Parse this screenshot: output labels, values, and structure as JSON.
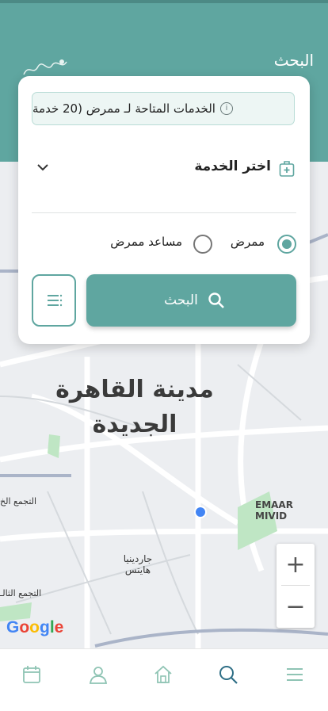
{
  "header": {
    "title": "البحث"
  },
  "search_card": {
    "info_text": "الخدمات المتاحة لـ ممرض (20 خدمة",
    "service_select": "اختر الخدمة",
    "radio_nurse": "ممرض",
    "radio_assistant": "مساعد ممرض",
    "selected_option": "ممرض",
    "search_button": "البحث"
  },
  "map": {
    "city": "مدينة القاهرة الجديدة",
    "labels": {
      "gardenia": "جاردينيا هايتس",
      "emaar": "EMAAR MIVID",
      "tagamoa_top": "التجمع الخ",
      "tagamoa_bottom": "التجمع الثالـ"
    },
    "google": "Google",
    "zoom_in": "+",
    "zoom_out": "−"
  },
  "colors": {
    "primary": "#5fa6a0",
    "accent_blue": "#4285f4",
    "nav_icon": "#8fc4b4",
    "nav_active": "#2f6f86"
  },
  "bottom_nav": [
    {
      "name": "calendar-icon"
    },
    {
      "name": "user-icon"
    },
    {
      "name": "home-icon"
    },
    {
      "name": "search-icon"
    },
    {
      "name": "menu-icon"
    }
  ]
}
